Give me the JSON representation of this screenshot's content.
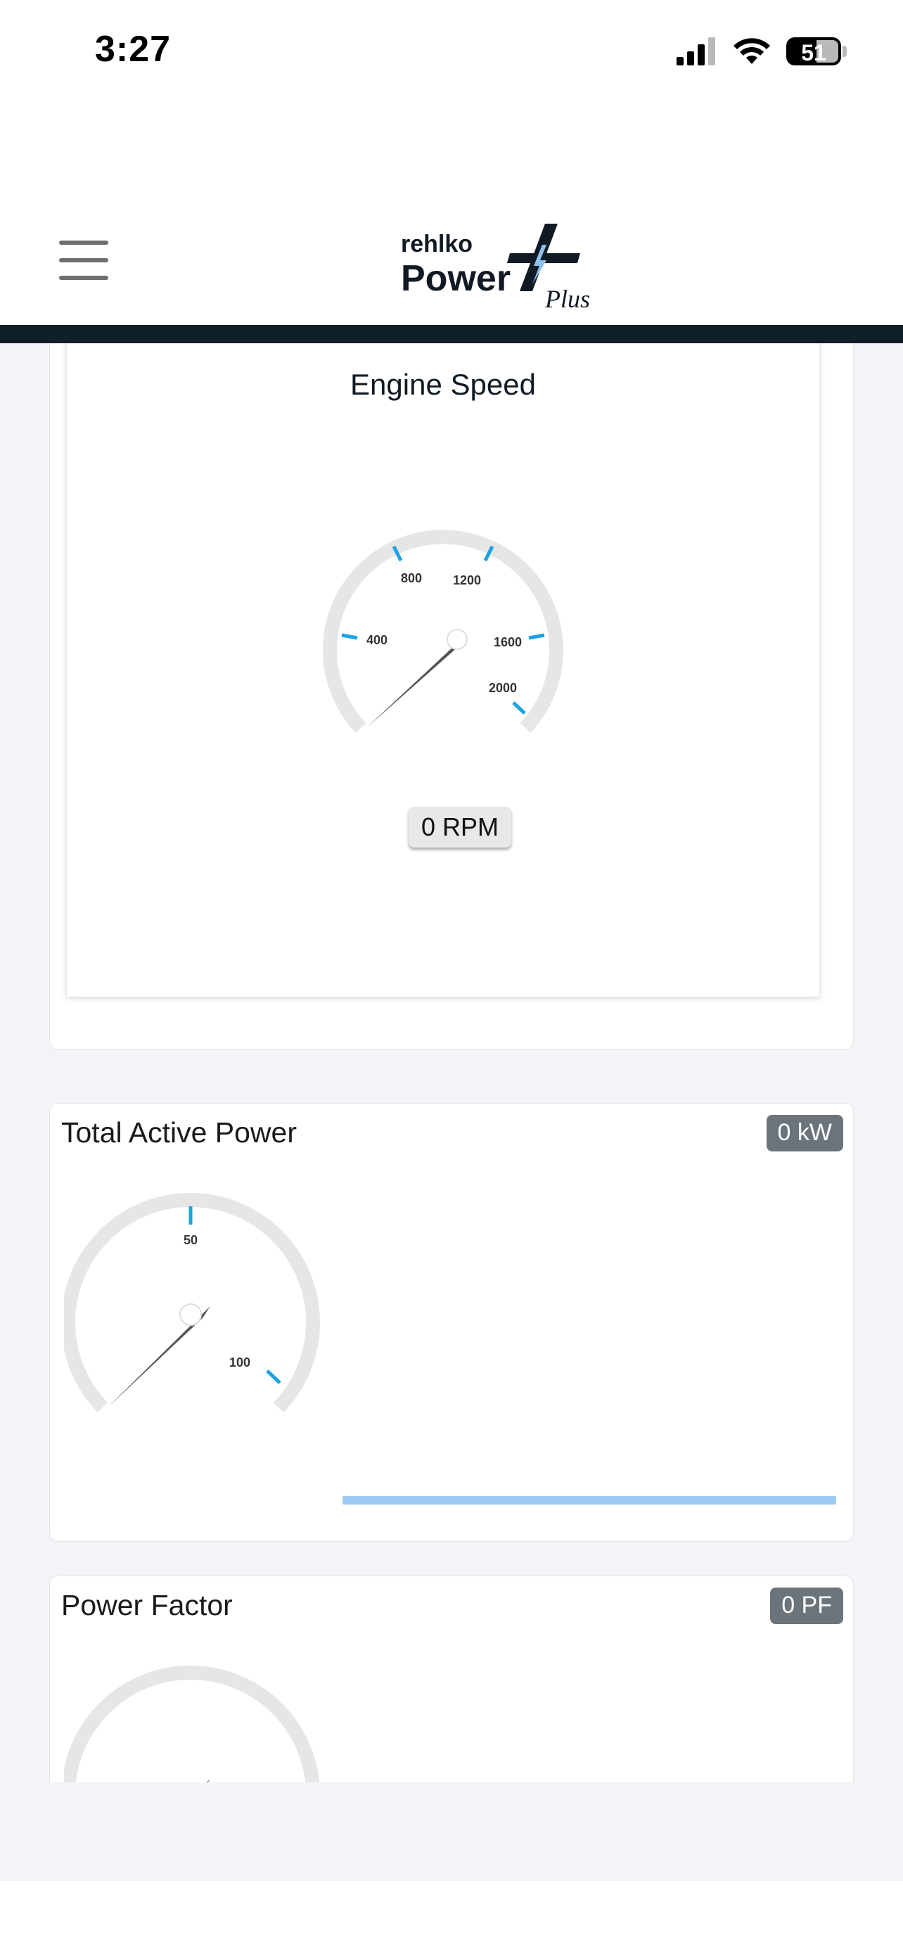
{
  "status_bar": {
    "time": "3:27",
    "battery": "51",
    "icons": [
      "signal-icon",
      "wifi-icon",
      "battery-icon"
    ]
  },
  "header": {
    "menu_icon": "hamburger-menu-icon",
    "logo": {
      "top": "rehlko",
      "main": "Power",
      "suffix": "Plus"
    }
  },
  "engine_speed": {
    "title": "Engine Speed",
    "value_label": "0 RPM",
    "gauge": {
      "min": 0,
      "max": 2400,
      "value": 0,
      "ticks": [
        "400",
        "800",
        "1200",
        "1600",
        "2000"
      ]
    }
  },
  "total_active_power": {
    "title": "Total Active Power",
    "badge": "0 kW",
    "gauge": {
      "min": 0,
      "max": 120,
      "value": 0,
      "ticks": [
        "50",
        "100"
      ]
    },
    "progress": 0
  },
  "power_factor": {
    "title": "Power Factor",
    "badge": "0 PF"
  },
  "colors": {
    "accent_tick": "#19a3e0",
    "header_bar": "#0f1f2a",
    "badge_bg": "#6b737b",
    "progress": "#9ccaf3"
  }
}
